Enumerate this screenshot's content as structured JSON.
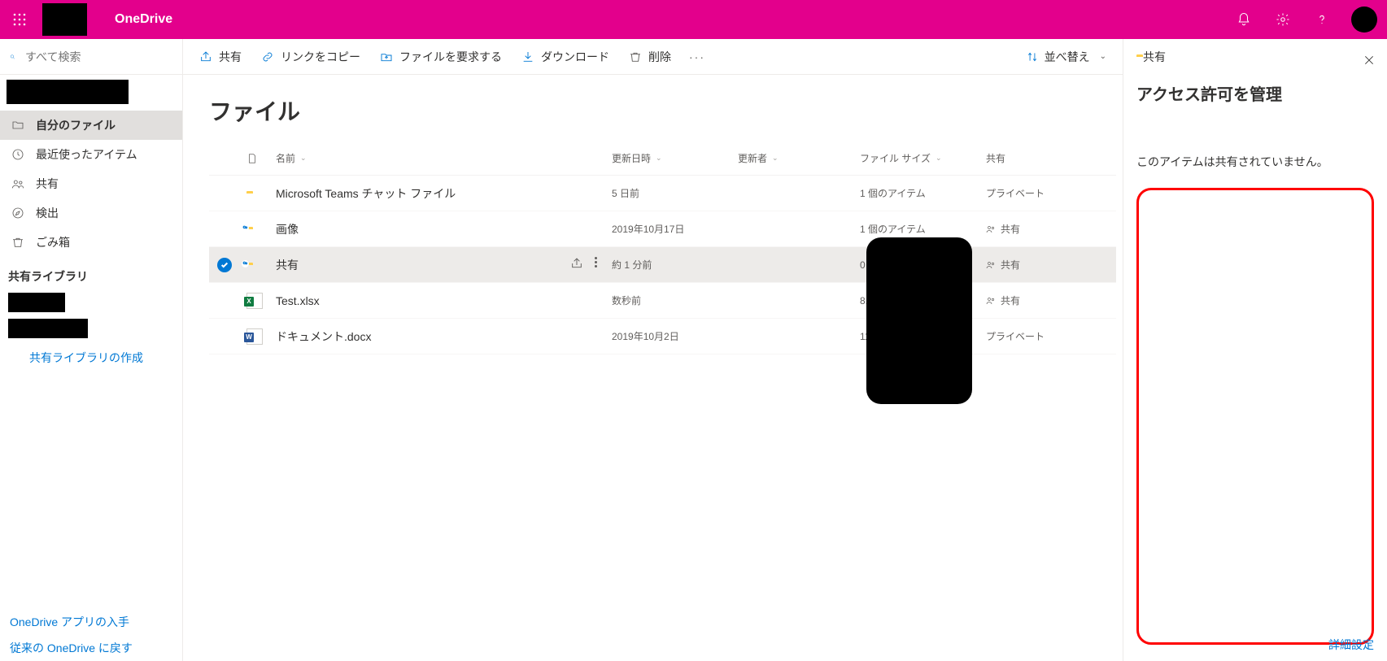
{
  "header": {
    "app_name": "OneDrive"
  },
  "search": {
    "placeholder": "すべて検索"
  },
  "nav": {
    "my_files": "自分のファイル",
    "recent": "最近使ったアイテム",
    "shared": "共有",
    "discover": "検出",
    "recycle": "ごみ箱",
    "libraries_label": "共有ライブラリ",
    "create_library": "共有ライブラリの作成",
    "get_app": "OneDrive アプリの入手",
    "classic": "従来の OneDrive に戻す"
  },
  "cmdbar": {
    "share": "共有",
    "copy_link": "リンクをコピー",
    "request_files": "ファイルを要求する",
    "download": "ダウンロード",
    "delete": "削除",
    "sort": "並べ替え"
  },
  "page": {
    "title": "ファイル"
  },
  "columns": {
    "name": "名前",
    "modified": "更新日時",
    "modified_by": "更新者",
    "size": "ファイル サイズ",
    "sharing": "共有"
  },
  "files": [
    {
      "name": "Microsoft Teams チャット ファイル",
      "type": "folder",
      "modified": "5 日前",
      "size": "1 個のアイテム",
      "sharing": "プライベート",
      "share_icon": false
    },
    {
      "name": "画像",
      "type": "folder_shared",
      "modified": "2019年10月17日",
      "size": "1 個のアイテム",
      "sharing": "共有",
      "share_icon": true
    },
    {
      "name": "共有",
      "type": "folder_shared",
      "modified": "約 1 分前",
      "size": "0 個のアイテム",
      "sharing": "共有",
      "share_icon": true,
      "selected": true
    },
    {
      "name": "Test.xlsx",
      "type": "xlsx",
      "modified": "数秒前",
      "size": "8.27 KB",
      "sharing": "共有",
      "share_icon": true
    },
    {
      "name": "ドキュメント.docx",
      "type": "docx",
      "modified": "2019年10月2日",
      "size": "11.1 KB",
      "sharing": "プライベート",
      "share_icon": false
    }
  ],
  "panel": {
    "folder_label": "共有",
    "title": "アクセス許可を管理",
    "message": "このアイテムは共有されていません。",
    "advanced": "詳細設定"
  }
}
